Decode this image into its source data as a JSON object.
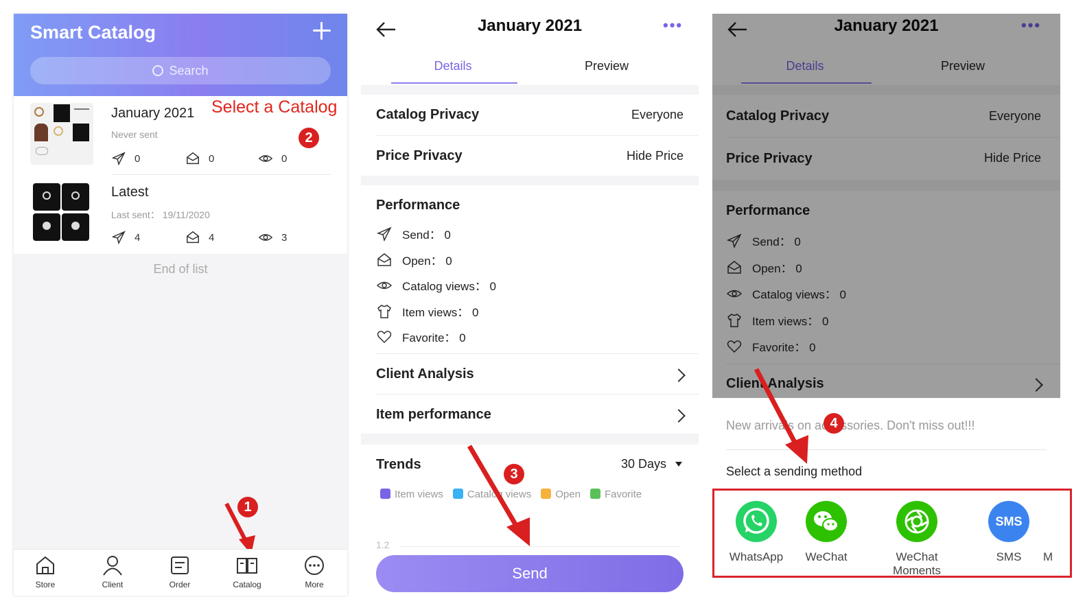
{
  "colors": {
    "accent": "#8a7ef0",
    "annotation_red": "#e0261d",
    "whatsapp": "#25d366",
    "wechat": "#2dc100",
    "sms": "#3b84f0"
  },
  "panel1": {
    "title": "Smart Catalog",
    "search_placeholder": "Search",
    "catalogs": [
      {
        "title": "January 2021",
        "subtitle": "Never sent",
        "sent": "0",
        "opened": "0",
        "views": "0"
      },
      {
        "title": "Latest",
        "subtitle": "Last sent： 19/11/2020",
        "sent": "4",
        "opened": "4",
        "views": "3"
      }
    ],
    "end_of_list": "End of list",
    "annotation_select": "Select a Catalog",
    "tabs": [
      "Store",
      "Client",
      "Order",
      "Catalog",
      "More"
    ]
  },
  "panel2": {
    "title": "January 2021",
    "tabs": [
      "Details",
      "Preview"
    ],
    "privacy": [
      {
        "label": "Catalog Privacy",
        "value": "Everyone"
      },
      {
        "label": "Price Privacy",
        "value": "Hide Price"
      }
    ],
    "performance_title": "Performance",
    "performance": [
      {
        "icon": "send-icon",
        "text": "Send： 0"
      },
      {
        "icon": "open-mail-icon",
        "text": "Open： 0"
      },
      {
        "icon": "eye-icon",
        "text": "Catalog views： 0"
      },
      {
        "icon": "shirt-icon",
        "text": "Item views： 0"
      },
      {
        "icon": "heart-icon",
        "text": "Favorite： 0"
      }
    ],
    "links": [
      "Client Analysis",
      "Item performance"
    ],
    "trends_title": "Trends",
    "trends_range": "30 Days",
    "legend": [
      {
        "label": "Item views",
        "color": "#7b63e6"
      },
      {
        "label": "Catalog views",
        "color": "#3ab1f3"
      },
      {
        "label": "Open",
        "color": "#f5b23d"
      },
      {
        "label": "Favorite",
        "color": "#5cc05a"
      }
    ],
    "axis_value": "1.2",
    "send_label": "Send"
  },
  "panel3": {
    "title": "January 2021",
    "tabs": [
      "Details",
      "Preview"
    ],
    "privacy": [
      {
        "label": "Catalog Privacy",
        "value": "Everyone"
      },
      {
        "label": "Price Privacy",
        "value": "Hide Price"
      }
    ],
    "performance_title": "Performance",
    "performance": [
      "Send： 0",
      "Open： 0",
      "Catalog views： 0",
      "Item views： 0",
      "Favorite： 0"
    ],
    "client_analysis": "Client Analysis",
    "message": "New arrivals on accessories. Don't miss out!!!",
    "sending_method_label": "Select a sending method",
    "methods": [
      "WhatsApp",
      "WeChat",
      "WeChat Moments",
      "SMS",
      "M"
    ]
  },
  "badges": [
    "1",
    "2",
    "3",
    "4"
  ]
}
